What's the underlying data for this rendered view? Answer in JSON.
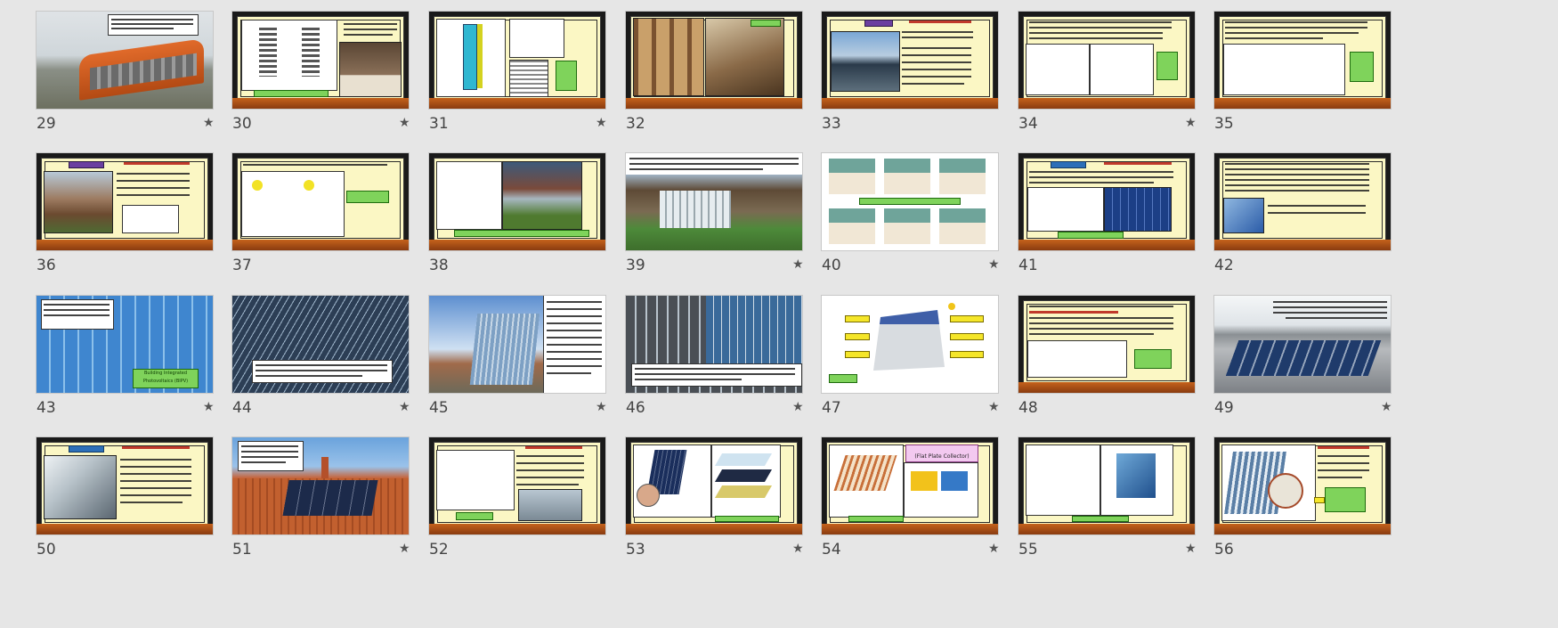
{
  "slides": [
    {
      "num": "29",
      "starred": true
    },
    {
      "num": "30",
      "starred": true
    },
    {
      "num": "31",
      "starred": true
    },
    {
      "num": "32",
      "starred": false
    },
    {
      "num": "33",
      "starred": false
    },
    {
      "num": "34",
      "starred": true
    },
    {
      "num": "35",
      "starred": false
    },
    {
      "num": "36",
      "starred": false
    },
    {
      "num": "37",
      "starred": false
    },
    {
      "num": "38",
      "starred": false
    },
    {
      "num": "39",
      "starred": true
    },
    {
      "num": "40",
      "starred": true
    },
    {
      "num": "41",
      "starred": false
    },
    {
      "num": "42",
      "starred": false
    },
    {
      "num": "43",
      "starred": true
    },
    {
      "num": "44",
      "starred": true
    },
    {
      "num": "45",
      "starred": true
    },
    {
      "num": "46",
      "starred": true
    },
    {
      "num": "47",
      "starred": true
    },
    {
      "num": "48",
      "starred": false
    },
    {
      "num": "49",
      "starred": true
    },
    {
      "num": "50",
      "starred": false
    },
    {
      "num": "51",
      "starred": true
    },
    {
      "num": "52",
      "starred": false
    },
    {
      "num": "53",
      "starred": true
    },
    {
      "num": "54",
      "starred": true
    },
    {
      "num": "55",
      "starred": true
    },
    {
      "num": "56",
      "starred": false
    }
  ],
  "star_glyph": "★",
  "thumb_texts": {
    "s43_label": "Building Integrated Photovoltaics (BIPV)",
    "s54_title": "(Flat Plate Collector)"
  },
  "colors": {
    "background": "#e6e6e6",
    "frame_cream": "#fbf7c4",
    "frame_wood": "#c5621c",
    "accent_green": "#7fd35b",
    "accent_purple": "#6b3fa0",
    "accent_red": "#c0392b"
  }
}
